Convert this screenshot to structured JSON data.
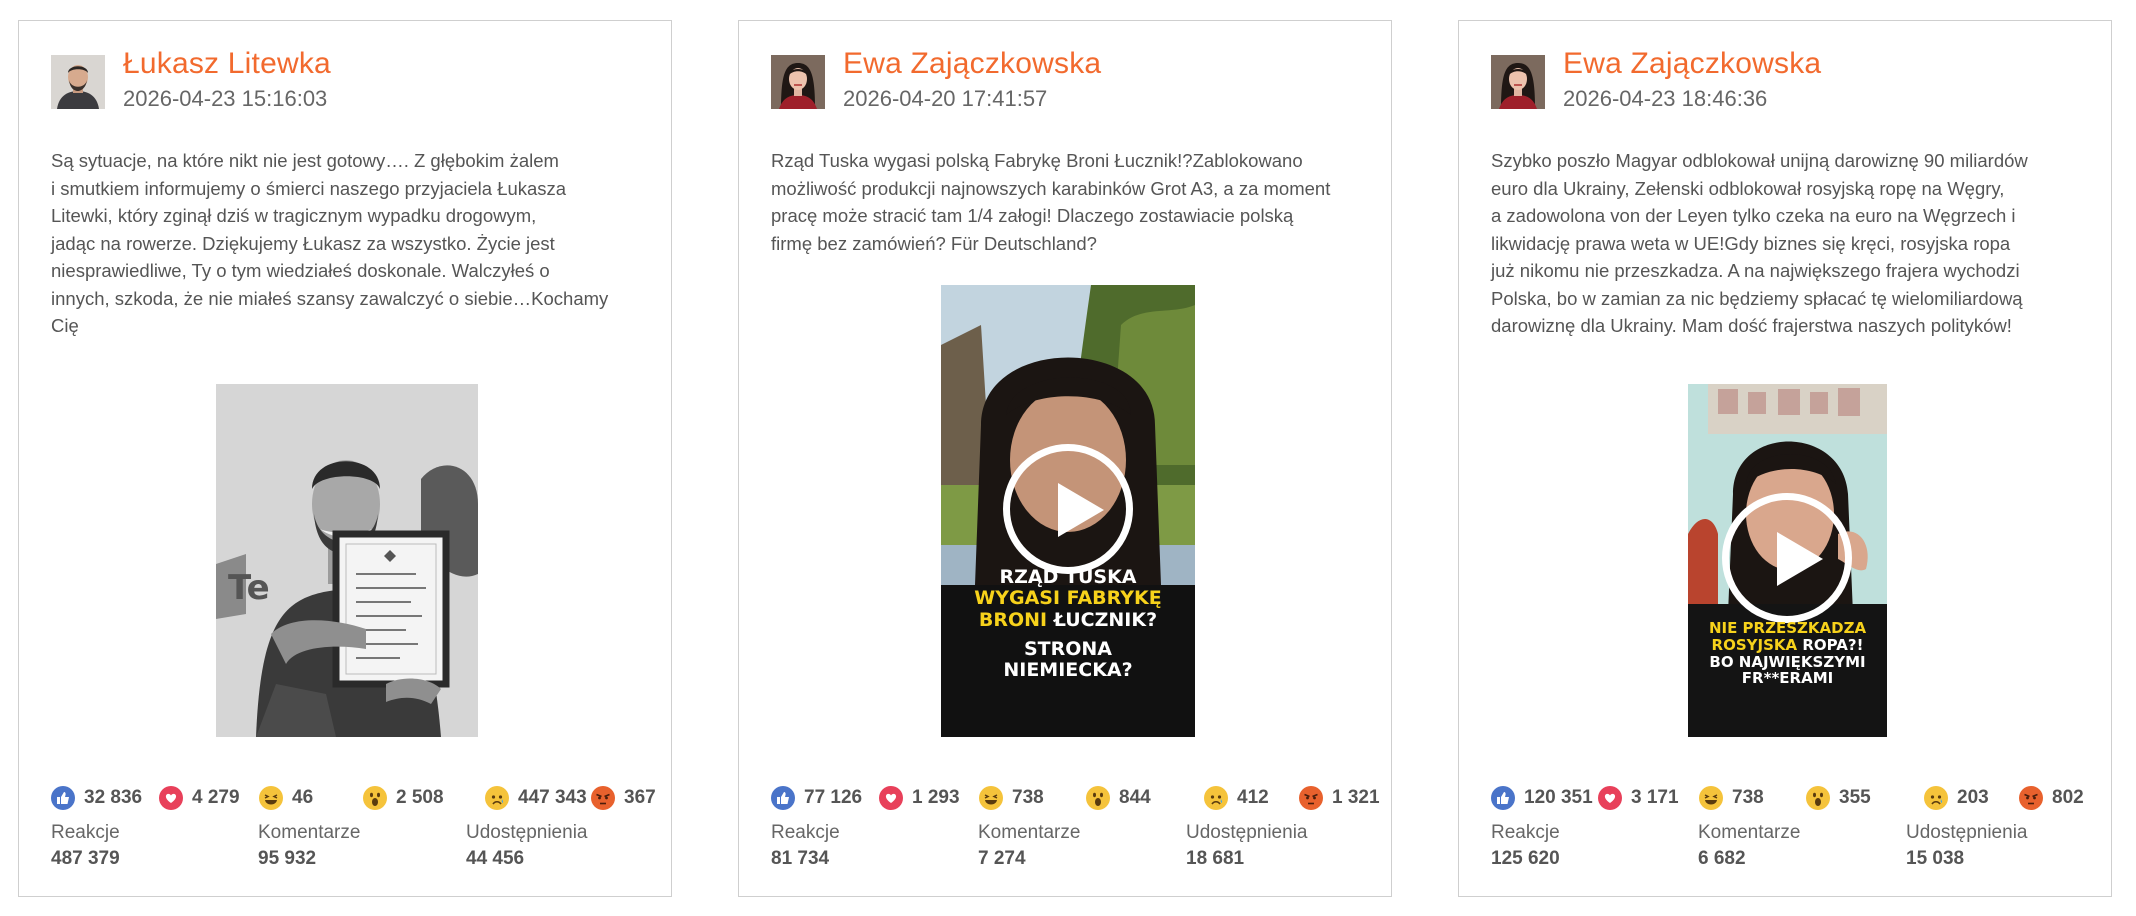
{
  "colors": {
    "author_accent": "#f26a2e",
    "like": "#4a74c9",
    "love": "#e8405a",
    "emoji_yellow": "#f5c33b",
    "angry": "#e8612d",
    "caption_highlight": "#f7d21b"
  },
  "posts": [
    {
      "author": "Łukasz Litewka",
      "timestamp": "2026-04-23 15:16:03",
      "text": "Są sytuacje, na które nikt nie jest gotowy…. Z głębokim żalem\ni smutkiem informujemy o śmierci naszego przyjaciela Łukasza\nLitewki, który zginął dziś w tragicznym wypadku drogowym,\njadąc na rowerze. Dziękujemy Łukasz za wszystko. Życie jest\nniesprawiedliwe, Ty o tym wiedziałeś doskonale. Walczyłeś o\ninnych, szkoda, że nie miałeś szansy zawalczyć o siebie…Kochamy\nCię",
      "media": {
        "kind": "photo",
        "icon": "grayscale-photo-man-with-framed-letter"
      },
      "reactions": {
        "like": "32 836",
        "love": "4 279",
        "haha": "46",
        "wow": "2 508",
        "sad": "447 343",
        "angry": "367"
      },
      "stats": [
        {
          "label": "Reakcje",
          "value": "487 379"
        },
        {
          "label": "Komentarze",
          "value": "95 932"
        },
        {
          "label": "Udostępnienia",
          "value": "44 456"
        }
      ]
    },
    {
      "author": "Ewa Zajączkowska",
      "timestamp": "2026-04-20 17:41:57",
      "text": "Rząd Tuska wygasi polską Fabrykę Broni Łucznik!?Zablokowano\nmożliwość produkcji najnowszych karabinków Grot A3, a za moment\npracę może stracić tam 1/4 załogi! Dlaczego zostawiacie polską\nfirmę bez zamówień? Für Deutschland?",
      "media": {
        "kind": "video",
        "icon": "play-icon",
        "caption": [
          {
            "text": "RZĄD TUSKA",
            "highlight": false
          },
          {
            "text": "WYGASI FABRYKĘ",
            "highlight": true
          },
          {
            "text": "BRONI",
            "highlight": true
          },
          {
            "text": "ŁUCZNIK?",
            "highlight": false
          },
          {
            "text": "STRONA",
            "highlight": false
          },
          {
            "text": "NIEMIECKA?",
            "highlight": false
          }
        ]
      },
      "reactions": {
        "like": "77 126",
        "love": "1 293",
        "haha": "738",
        "wow": "844",
        "sad": "412",
        "angry": "1 321"
      },
      "stats": [
        {
          "label": "Reakcje",
          "value": "81 734"
        },
        {
          "label": "Komentarze",
          "value": "7 274"
        },
        {
          "label": "Udostępnienia",
          "value": "18 681"
        }
      ]
    },
    {
      "author": "Ewa Zajączkowska",
      "timestamp": "2026-04-23 18:46:36",
      "text": "Szybko poszło Magyar odblokował unijną darowiznę 90 miliardów\neuro dla Ukrainy, Zełenski odblokował rosyjską ropę na Węgry,\na zadowolona von der Leyen tylko czeka na euro na Węgrzech i\nlikwidację prawa weta w UE!Gdy biznes się kręci, rosyjska ropa\njuż nikomu nie przeszkadza. A na największego frajera wychodzi\nPolska, bo w zamian za nic będziemy spłacać tę wielomiliardową\ndarowiznę dla Ukrainy. Mam dość frajerstwa naszych polityków!",
      "media": {
        "kind": "video",
        "icon": "play-icon",
        "caption": [
          {
            "text": "NIE PRZESZKADZA",
            "highlight": true
          },
          {
            "text": "ROSYJSKA",
            "highlight": true
          },
          {
            "text": "ROPA?!",
            "highlight": false
          },
          {
            "text": "BO NAJWIĘKSZYMI",
            "highlight": false
          },
          {
            "text": "FR**ERAMI",
            "highlight": false
          }
        ]
      },
      "reactions": {
        "like": "120 351",
        "love": "3 171",
        "haha": "738",
        "wow": "355",
        "sad": "203",
        "angry": "802"
      },
      "stats": [
        {
          "label": "Reakcje",
          "value": "125 620"
        },
        {
          "label": "Komentarze",
          "value": "6 682"
        },
        {
          "label": "Udostępnienia",
          "value": "15 038"
        }
      ]
    }
  ]
}
